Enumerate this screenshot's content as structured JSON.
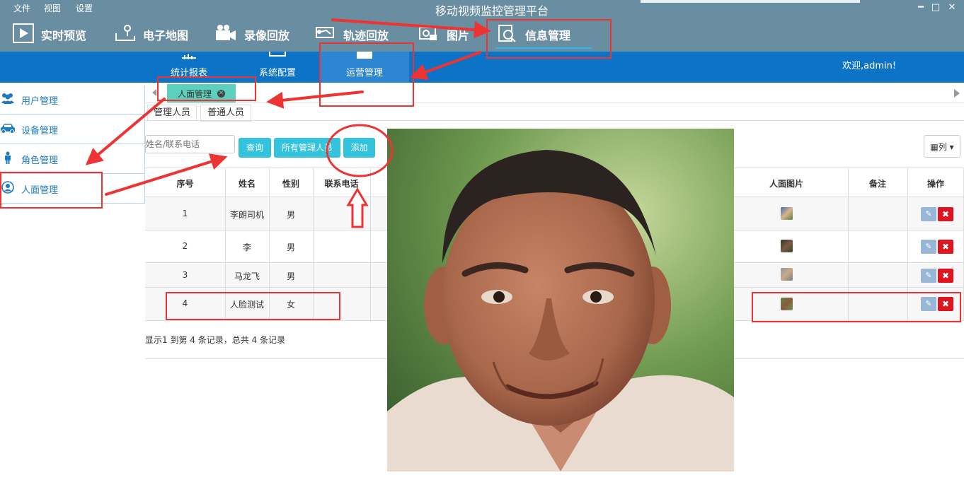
{
  "menubar": {
    "items": [
      "文件",
      "视图",
      "设置"
    ],
    "title": "移动视频监控管理平台"
  },
  "window_controls": {
    "minimize": "━",
    "maximize": "□",
    "close": "✕"
  },
  "mainnav": {
    "items": [
      {
        "label": "实时预览",
        "icon": "play-icon"
      },
      {
        "label": "电子地图",
        "icon": "map-pin-icon"
      },
      {
        "label": "录像回放",
        "icon": "video-camera-icon"
      },
      {
        "label": "轨迹回放",
        "icon": "track-icon"
      },
      {
        "label": "图片",
        "icon": "picture-icon"
      },
      {
        "label": "信息管理",
        "icon": "info-search-icon",
        "active": true
      }
    ]
  },
  "subnav": {
    "items": [
      {
        "label": "统计报表"
      },
      {
        "label": "系统配置"
      },
      {
        "label": "运营管理",
        "active": true
      }
    ],
    "welcome": "欢迎,admin!"
  },
  "sidebar": {
    "items": [
      {
        "label": "用户管理",
        "icon": "users-icon"
      },
      {
        "label": "设备管理",
        "icon": "car-icon"
      },
      {
        "label": "角色管理",
        "icon": "person-icon"
      },
      {
        "label": "人面管理",
        "icon": "user-circle-icon",
        "active": true
      }
    ]
  },
  "tabs": {
    "open_tab": "人面管理",
    "close_glyph": "✕"
  },
  "subtabs": [
    "管理人员",
    "普通人员"
  ],
  "toolbar": {
    "search_placeholder": "姓名/联系电话",
    "query": "查询",
    "all_admins": "所有管理人员",
    "add": "添加",
    "columns": "列"
  },
  "table": {
    "headers": [
      "序号",
      "姓名",
      "性别",
      "联系电话",
      "人面图片",
      "备注",
      "操作"
    ],
    "rows": [
      {
        "no": "1",
        "name": "李朗司机",
        "gender": "男",
        "phone": "",
        "note": ""
      },
      {
        "no": "2",
        "name": "李",
        "gender": "男",
        "phone": "",
        "note": ""
      },
      {
        "no": "3",
        "name": "马龙飞",
        "gender": "男",
        "phone": "",
        "note": ""
      },
      {
        "no": "4",
        "name": "人脸测试",
        "gender": "女",
        "phone": "",
        "note": ""
      }
    ]
  },
  "pager": "显示1 到第 4 条记录，总共 4 条记录",
  "colors": {
    "header": "#698ea2",
    "subnav": "#0d73c7",
    "accent": "#33c3dc",
    "annotation": "#ee3333",
    "delete": "#e0141f"
  }
}
